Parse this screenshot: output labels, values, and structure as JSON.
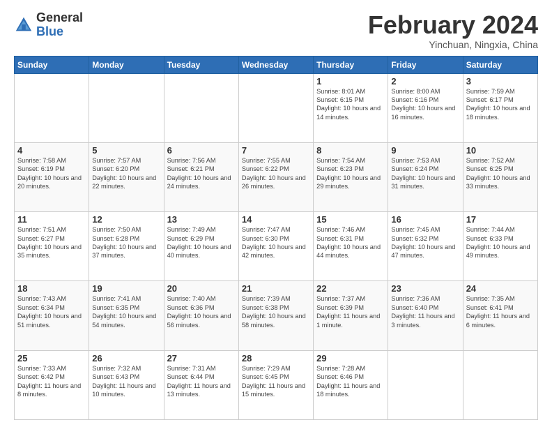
{
  "logo": {
    "general": "General",
    "blue": "Blue"
  },
  "header": {
    "title": "February 2024",
    "subtitle": "Yinchuan, Ningxia, China"
  },
  "weekdays": [
    "Sunday",
    "Monday",
    "Tuesday",
    "Wednesday",
    "Thursday",
    "Friday",
    "Saturday"
  ],
  "weeks": [
    [
      {
        "day": "",
        "info": ""
      },
      {
        "day": "",
        "info": ""
      },
      {
        "day": "",
        "info": ""
      },
      {
        "day": "",
        "info": ""
      },
      {
        "day": "1",
        "info": "Sunrise: 8:01 AM\nSunset: 6:15 PM\nDaylight: 10 hours and 14 minutes."
      },
      {
        "day": "2",
        "info": "Sunrise: 8:00 AM\nSunset: 6:16 PM\nDaylight: 10 hours and 16 minutes."
      },
      {
        "day": "3",
        "info": "Sunrise: 7:59 AM\nSunset: 6:17 PM\nDaylight: 10 hours and 18 minutes."
      }
    ],
    [
      {
        "day": "4",
        "info": "Sunrise: 7:58 AM\nSunset: 6:19 PM\nDaylight: 10 hours and 20 minutes."
      },
      {
        "day": "5",
        "info": "Sunrise: 7:57 AM\nSunset: 6:20 PM\nDaylight: 10 hours and 22 minutes."
      },
      {
        "day": "6",
        "info": "Sunrise: 7:56 AM\nSunset: 6:21 PM\nDaylight: 10 hours and 24 minutes."
      },
      {
        "day": "7",
        "info": "Sunrise: 7:55 AM\nSunset: 6:22 PM\nDaylight: 10 hours and 26 minutes."
      },
      {
        "day": "8",
        "info": "Sunrise: 7:54 AM\nSunset: 6:23 PM\nDaylight: 10 hours and 29 minutes."
      },
      {
        "day": "9",
        "info": "Sunrise: 7:53 AM\nSunset: 6:24 PM\nDaylight: 10 hours and 31 minutes."
      },
      {
        "day": "10",
        "info": "Sunrise: 7:52 AM\nSunset: 6:25 PM\nDaylight: 10 hours and 33 minutes."
      }
    ],
    [
      {
        "day": "11",
        "info": "Sunrise: 7:51 AM\nSunset: 6:27 PM\nDaylight: 10 hours and 35 minutes."
      },
      {
        "day": "12",
        "info": "Sunrise: 7:50 AM\nSunset: 6:28 PM\nDaylight: 10 hours and 37 minutes."
      },
      {
        "day": "13",
        "info": "Sunrise: 7:49 AM\nSunset: 6:29 PM\nDaylight: 10 hours and 40 minutes."
      },
      {
        "day": "14",
        "info": "Sunrise: 7:47 AM\nSunset: 6:30 PM\nDaylight: 10 hours and 42 minutes."
      },
      {
        "day": "15",
        "info": "Sunrise: 7:46 AM\nSunset: 6:31 PM\nDaylight: 10 hours and 44 minutes."
      },
      {
        "day": "16",
        "info": "Sunrise: 7:45 AM\nSunset: 6:32 PM\nDaylight: 10 hours and 47 minutes."
      },
      {
        "day": "17",
        "info": "Sunrise: 7:44 AM\nSunset: 6:33 PM\nDaylight: 10 hours and 49 minutes."
      }
    ],
    [
      {
        "day": "18",
        "info": "Sunrise: 7:43 AM\nSunset: 6:34 PM\nDaylight: 10 hours and 51 minutes."
      },
      {
        "day": "19",
        "info": "Sunrise: 7:41 AM\nSunset: 6:35 PM\nDaylight: 10 hours and 54 minutes."
      },
      {
        "day": "20",
        "info": "Sunrise: 7:40 AM\nSunset: 6:36 PM\nDaylight: 10 hours and 56 minutes."
      },
      {
        "day": "21",
        "info": "Sunrise: 7:39 AM\nSunset: 6:38 PM\nDaylight: 10 hours and 58 minutes."
      },
      {
        "day": "22",
        "info": "Sunrise: 7:37 AM\nSunset: 6:39 PM\nDaylight: 11 hours and 1 minute."
      },
      {
        "day": "23",
        "info": "Sunrise: 7:36 AM\nSunset: 6:40 PM\nDaylight: 11 hours and 3 minutes."
      },
      {
        "day": "24",
        "info": "Sunrise: 7:35 AM\nSunset: 6:41 PM\nDaylight: 11 hours and 6 minutes."
      }
    ],
    [
      {
        "day": "25",
        "info": "Sunrise: 7:33 AM\nSunset: 6:42 PM\nDaylight: 11 hours and 8 minutes."
      },
      {
        "day": "26",
        "info": "Sunrise: 7:32 AM\nSunset: 6:43 PM\nDaylight: 11 hours and 10 minutes."
      },
      {
        "day": "27",
        "info": "Sunrise: 7:31 AM\nSunset: 6:44 PM\nDaylight: 11 hours and 13 minutes."
      },
      {
        "day": "28",
        "info": "Sunrise: 7:29 AM\nSunset: 6:45 PM\nDaylight: 11 hours and 15 minutes."
      },
      {
        "day": "29",
        "info": "Sunrise: 7:28 AM\nSunset: 6:46 PM\nDaylight: 11 hours and 18 minutes."
      },
      {
        "day": "",
        "info": ""
      },
      {
        "day": "",
        "info": ""
      }
    ]
  ]
}
